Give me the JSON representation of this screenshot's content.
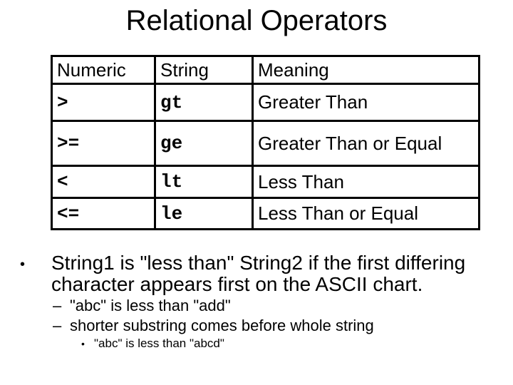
{
  "title": "Relational Operators",
  "table": {
    "headers": [
      "Numeric",
      "String",
      "Meaning"
    ],
    "rows": [
      {
        "numeric": ">",
        "string": "gt",
        "meaning": "Greater Than"
      },
      {
        "numeric": ">=",
        "string": "ge",
        "meaning": "Greater Than or Equal"
      },
      {
        "numeric": "<",
        "string": "lt",
        "meaning": "Less Than"
      },
      {
        "numeric": "<=",
        "string": "le",
        "meaning": "Less Than or Equal"
      }
    ]
  },
  "bullets": {
    "main_line1": "String1 is \"less than\" String2 if the first differing",
    "main_line2": "character appears first on the ASCII chart.",
    "sub1": "\"abc\" is less than \"add\"",
    "sub2": "shorter substring comes before whole string",
    "subsub1": "\"abc\" is less than \"abcd\"",
    "bullet_glyph": "•",
    "dash_glyph": "–"
  }
}
